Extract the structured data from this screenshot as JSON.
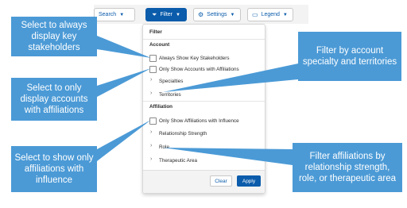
{
  "toolbar": {
    "search_label": "Search",
    "filter_label": "Filter",
    "settings_label": "Settings",
    "legend_label": "Legend"
  },
  "panel": {
    "title": "Filter",
    "account_heading": "Account",
    "always_show_key_stakeholders": "Always Show Key Stakeholders",
    "only_show_accounts_with_affiliations": "Only Show Accounts with Affiliations",
    "specialties": "Specialties",
    "territories": "Territories",
    "affiliation_heading": "Affiliation",
    "only_show_affiliations_with_influence": "Only Show Affiliations with Influence",
    "relationship_strength": "Relationship Strength",
    "role": "Role",
    "therapeutic_area": "Therapeutic Area",
    "clear_label": "Clear",
    "apply_label": "Apply"
  },
  "callouts": {
    "key_stakeholders": "Select to always display key stakeholders",
    "accounts_affiliations": "Select to only display accounts with affiliations",
    "affiliations_influence": "Select to show only affiliations with influence",
    "specialty_territories": "Filter by account specialty and territories",
    "affiliation_filters": "Filter affiliations by relationship strength, role, or therapeutic area"
  },
  "colors": {
    "callout_blue": "#4b9ad6",
    "brand_blue": "#0b5cab"
  }
}
